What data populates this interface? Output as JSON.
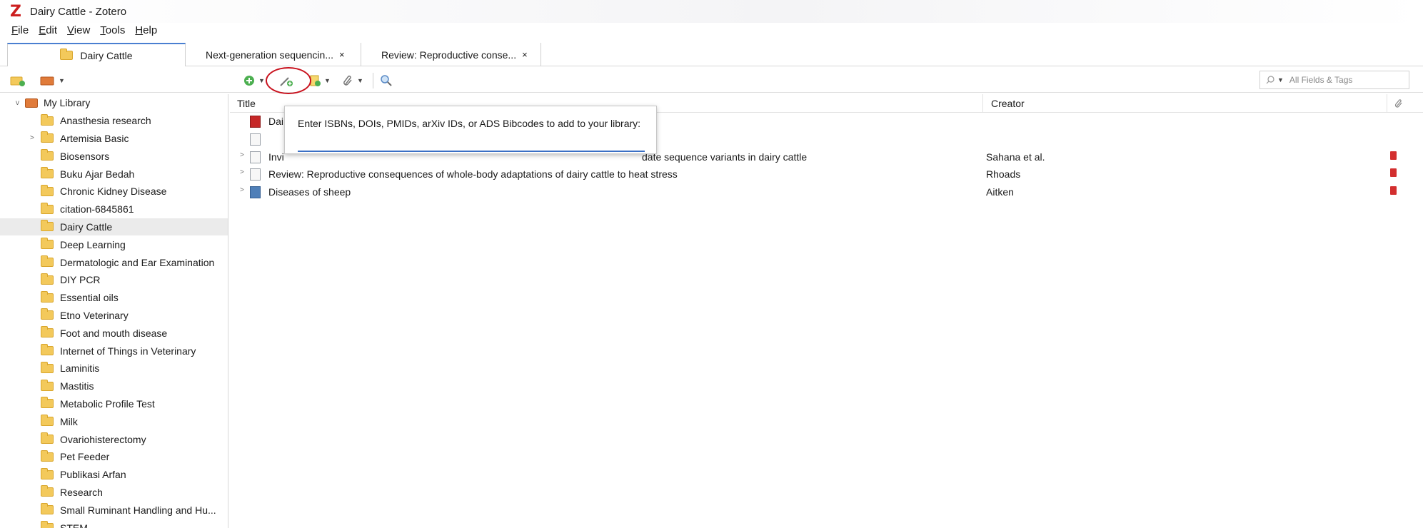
{
  "window": {
    "title": "Dairy Cattle - Zotero",
    "logo": "Z"
  },
  "menu": [
    "File",
    "Edit",
    "View",
    "Tools",
    "Help"
  ],
  "tabs": [
    {
      "label": "Dairy Cattle"
    },
    {
      "label": "Next-generation sequencin...",
      "close": "×"
    },
    {
      "label": "Review: Reproductive conse...",
      "close": "×"
    }
  ],
  "search": {
    "placeholder": "All Fields & Tags"
  },
  "columns": {
    "title": "Title",
    "creator": "Creator"
  },
  "library": {
    "root": "My Library",
    "collections": [
      "Anasthesia research",
      "Artemisia Basic",
      "Biosensors",
      "Buku Ajar Bedah",
      "Chronic Kidney Disease",
      "citation-6845861",
      "Dairy Cattle",
      "Deep Learning",
      "Dermatologic and Ear Examination",
      "DIY PCR",
      "Essential oils",
      "Etno Veterinary",
      "Foot and mouth disease",
      "Internet of Things in Veterinary",
      "Laminitis",
      "Mastitis",
      "Metabolic Profile Test",
      "Milk",
      "Ovariohisterectomy",
      "Pet Feeder",
      "Publikasi Arfan",
      "Research",
      "Small Ruminant Handling and Hu...",
      "STEM"
    ]
  },
  "items": [
    {
      "title": "Dai",
      "creator": ""
    },
    {
      "title": "",
      "creator": ""
    },
    {
      "title": "Invi",
      "title_tail": "date sequence variants in dairy cattle",
      "creator": "Sahana et al."
    },
    {
      "title": "Review: Reproductive consequences of whole-body adaptations of dairy cattle to heat stress",
      "creator": "Rhoads"
    },
    {
      "title": "Diseases of sheep",
      "creator": "Aitken"
    }
  ],
  "identifier_popup": {
    "label": "Enter ISBNs, DOIs, PMIDs, arXiv IDs, or ADS Bibcodes to add to your library:",
    "value": ""
  },
  "colors": {
    "accent": "#3a6fc4",
    "highlight": "#c8101c",
    "brand": "#cc1f1f"
  }
}
